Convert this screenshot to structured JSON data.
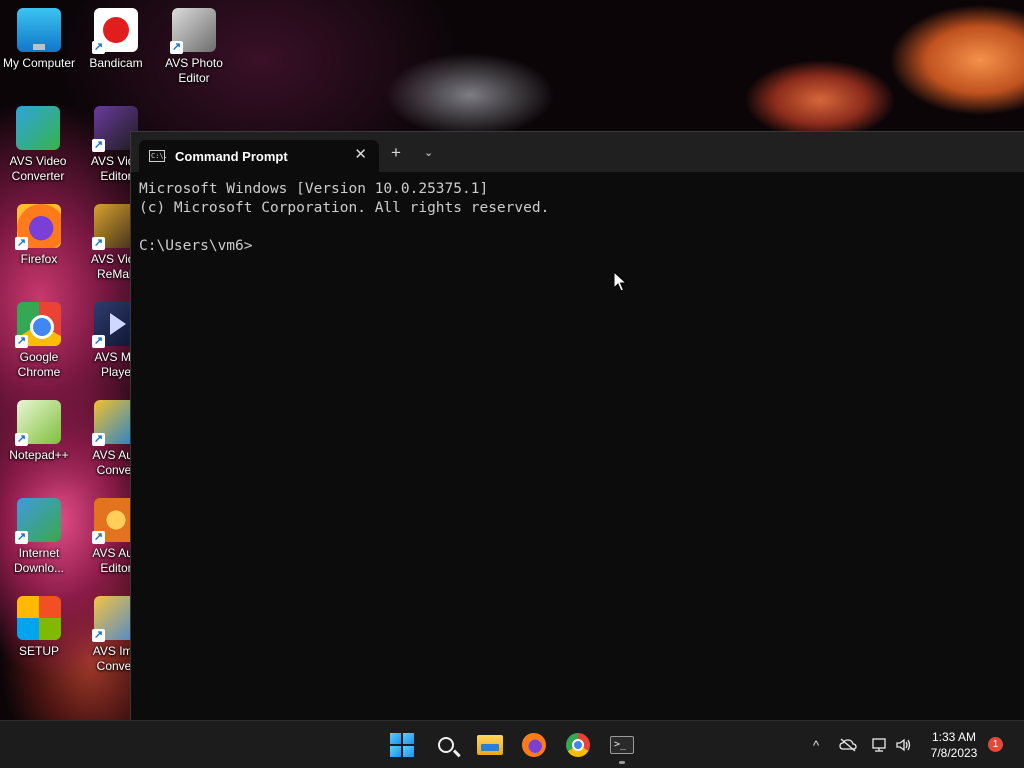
{
  "desktop": {
    "icons": [
      {
        "label": "My Computer",
        "icon": "computer-icon"
      },
      {
        "label": "Bandicam",
        "icon": "bandicam-icon"
      },
      {
        "label": "AVS Photo Editor",
        "icon": "avs-photo-editor-icon"
      },
      {
        "label": "AVS Video Converter",
        "icon": "avs-video-converter-icon"
      },
      {
        "label": "AVS Vide Editor",
        "icon": "avs-video-editor-icon"
      },
      {
        "label": "Firefox",
        "icon": "firefox-icon"
      },
      {
        "label": "AVS Vide ReMak",
        "icon": "avs-video-remaker-icon"
      },
      {
        "label": "Google Chrome",
        "icon": "chrome-icon"
      },
      {
        "label": "AVS Me Playe",
        "icon": "avs-media-player-icon"
      },
      {
        "label": "Notepad++",
        "icon": "notepad-plus-plus-icon"
      },
      {
        "label": "AVS Aud Conver",
        "icon": "avs-audio-converter-icon"
      },
      {
        "label": "Internet Downlo...",
        "icon": "internet-download-manager-icon"
      },
      {
        "label": "AVS Aud Editor",
        "icon": "avs-audio-editor-icon"
      },
      {
        "label": "SETUP",
        "icon": "setup-icon"
      },
      {
        "label": "AVS Ima Conver",
        "icon": "avs-image-converter-icon"
      }
    ]
  },
  "terminal": {
    "tab_title": "Command Prompt",
    "tab_icon_text": "C:\\.",
    "close_glyph": "✕",
    "new_tab_glyph": "+",
    "dropdown_glyph": "⌄",
    "lines": [
      "Microsoft Windows [Version 10.0.25375.1]",
      "(c) Microsoft Corporation. All rights reserved.",
      "",
      "C:\\Users\\vm6>"
    ]
  },
  "taskbar": {
    "apps": [
      "start-icon",
      "search-icon",
      "file-explorer-icon",
      "firefox-icon",
      "chrome-icon",
      "terminal-icon"
    ],
    "term_glyph": ">_",
    "tray_chevron": "^",
    "clock_time": "1:33 AM",
    "clock_date": "7/8/2023",
    "notification_count": "1"
  }
}
